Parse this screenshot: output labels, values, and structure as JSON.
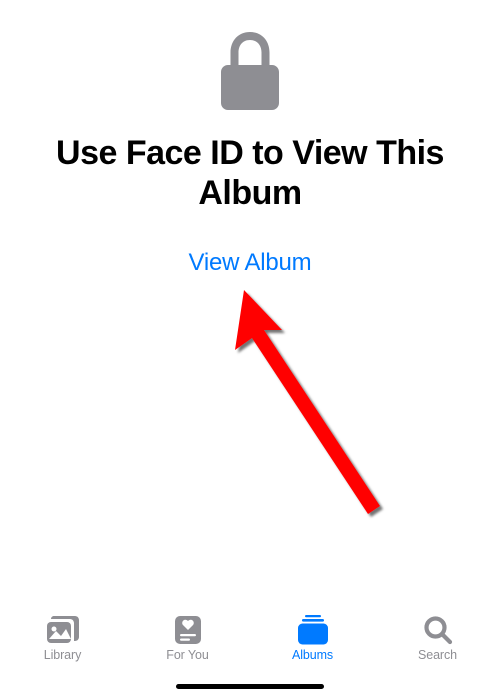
{
  "colors": {
    "accent": "#007aff",
    "inactive": "#8e8e93",
    "lock": "#8e8e93",
    "arrow": "#ff0000"
  },
  "lockedAlbum": {
    "title": "Use Face ID to View This Album",
    "viewButtonLabel": "View Album"
  },
  "tabs": [
    {
      "id": "library",
      "label": "Library",
      "active": false
    },
    {
      "id": "for-you",
      "label": "For You",
      "active": false
    },
    {
      "id": "albums",
      "label": "Albums",
      "active": true
    },
    {
      "id": "search",
      "label": "Search",
      "active": false
    }
  ]
}
